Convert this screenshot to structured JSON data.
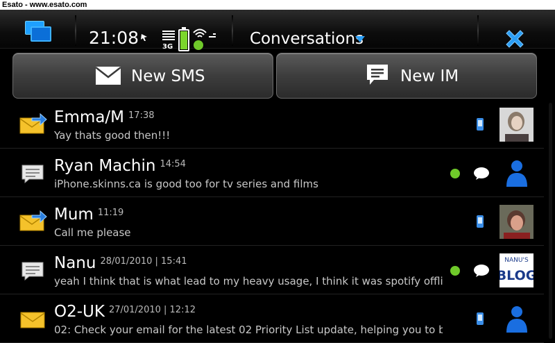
{
  "watermark": "Esato - www.esato.com",
  "status": {
    "clock": "21:08",
    "network": "3G",
    "battery_level": 1.0
  },
  "header": {
    "title": "Conversations",
    "icons": [
      "task-switcher-icon",
      "presence-icon",
      "signal-icon",
      "battery-icon",
      "wifi-icon",
      "close-icon"
    ],
    "accent_color": "#2a9df4"
  },
  "actions": {
    "new_sms": "New SMS",
    "new_im": "New IM"
  },
  "conversations": [
    {
      "name": "Emma/M",
      "time": "17:38",
      "message": "Yay thats good then!!!",
      "type": "sms-outgoing",
      "online": false,
      "channel": "phone",
      "avatar": "photo"
    },
    {
      "name": "Ryan Machin",
      "time": "14:54",
      "message": "iPhone.skinns.ca is good too for tv series and films",
      "type": "im",
      "online": true,
      "channel": "chat",
      "avatar": "default"
    },
    {
      "name": "Mum",
      "time": "11:19",
      "message": "Call me please",
      "type": "sms-outgoing",
      "online": false,
      "channel": "phone",
      "avatar": "photo"
    },
    {
      "name": "Nanu",
      "time": "28/01/2010 | 15:41",
      "message": "yeah I think that is what lead to my heavy usage, I think it was spotify offline",
      "type": "im",
      "online": true,
      "channel": "chat",
      "avatar": "blog"
    },
    {
      "name": "O2-UK",
      "time": "27/01/2010 | 12:12",
      "message": "02: Check your email for the latest 02 Priority List update, helping you to bank",
      "type": "sms",
      "online": false,
      "channel": "phone",
      "avatar": "default"
    }
  ],
  "avatar_text": {
    "blog_top": "NANU'S",
    "blog_main": "BLOG"
  }
}
